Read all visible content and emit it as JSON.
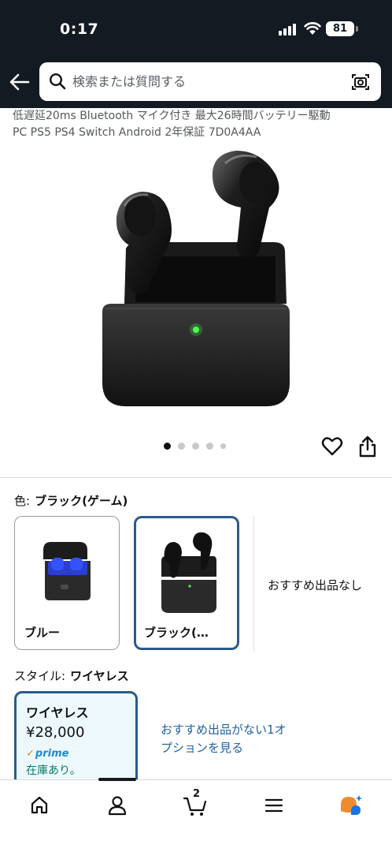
{
  "status_bar": {
    "time": "0:17",
    "battery": "81"
  },
  "search": {
    "placeholder": "検索または質問する"
  },
  "product": {
    "title_line1": "低遅延20ms Bluetooth マイク付き 最大26時間バッテリー駆動",
    "title_line2": "PC PS5 PS4 Switch Android 2年保証 7D0A4AA",
    "image_count": 5,
    "image_index": 1
  },
  "color": {
    "label": "色:",
    "selected": "ブラック(ゲーム)",
    "options": [
      {
        "label": "ブルー",
        "selected": false
      },
      {
        "label": "ブラック(…",
        "selected": true
      }
    ],
    "no_offers": "おすすめ出品なし"
  },
  "style": {
    "label": "スタイル:",
    "selected": "ワイヤレス",
    "card": {
      "name": "ワイヤレス",
      "price": "¥28,000",
      "prime": "prime",
      "stock": "在庫あり。"
    },
    "see_options": "おすすめ出品がない1オプションを見る"
  },
  "nav": {
    "items": [
      "home-icon",
      "account-icon",
      "cart-icon",
      "menu-icon",
      "rufus-icon"
    ],
    "cart_count": "2"
  },
  "colors": {
    "header_bg": "#131a22",
    "selected_border": "#2d5a8a",
    "link": "#2162a1",
    "stock_green": "#067d62",
    "prime_blue": "#1d8bd6",
    "rufus_orange": "#f08a2c",
    "rufus_blue": "#1a73e8"
  }
}
